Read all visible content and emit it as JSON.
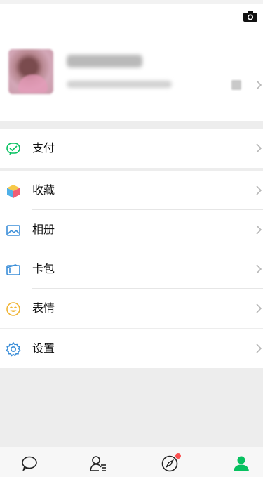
{
  "header": {
    "camera_icon": "camera-icon"
  },
  "profile": {
    "avatar_icon": "avatar",
    "qr_icon": "qr-code-icon"
  },
  "menu": {
    "pay": {
      "label": "支付",
      "icon": "pay-icon",
      "color": "#07c160"
    },
    "favorites": {
      "label": "收藏",
      "icon": "favorites-cube-icon"
    },
    "album": {
      "label": "相册",
      "icon": "album-icon",
      "color": "#3b8ed8"
    },
    "cards": {
      "label": "卡包",
      "icon": "card-wallet-icon",
      "color": "#3b8ed8"
    },
    "stickers": {
      "label": "表情",
      "icon": "sticker-smile-icon",
      "color": "#f0b536"
    },
    "settings": {
      "label": "设置",
      "icon": "settings-gear-icon",
      "color": "#3b8ed8"
    }
  },
  "tabbar": {
    "tabs": [
      {
        "icon": "chats-icon",
        "active": false
      },
      {
        "icon": "contacts-icon",
        "active": false
      },
      {
        "icon": "discover-compass-icon",
        "active": false,
        "badge": true
      },
      {
        "icon": "me-icon",
        "active": true
      }
    ],
    "active_color": "#07c160",
    "badge_color": "#fa5151"
  }
}
